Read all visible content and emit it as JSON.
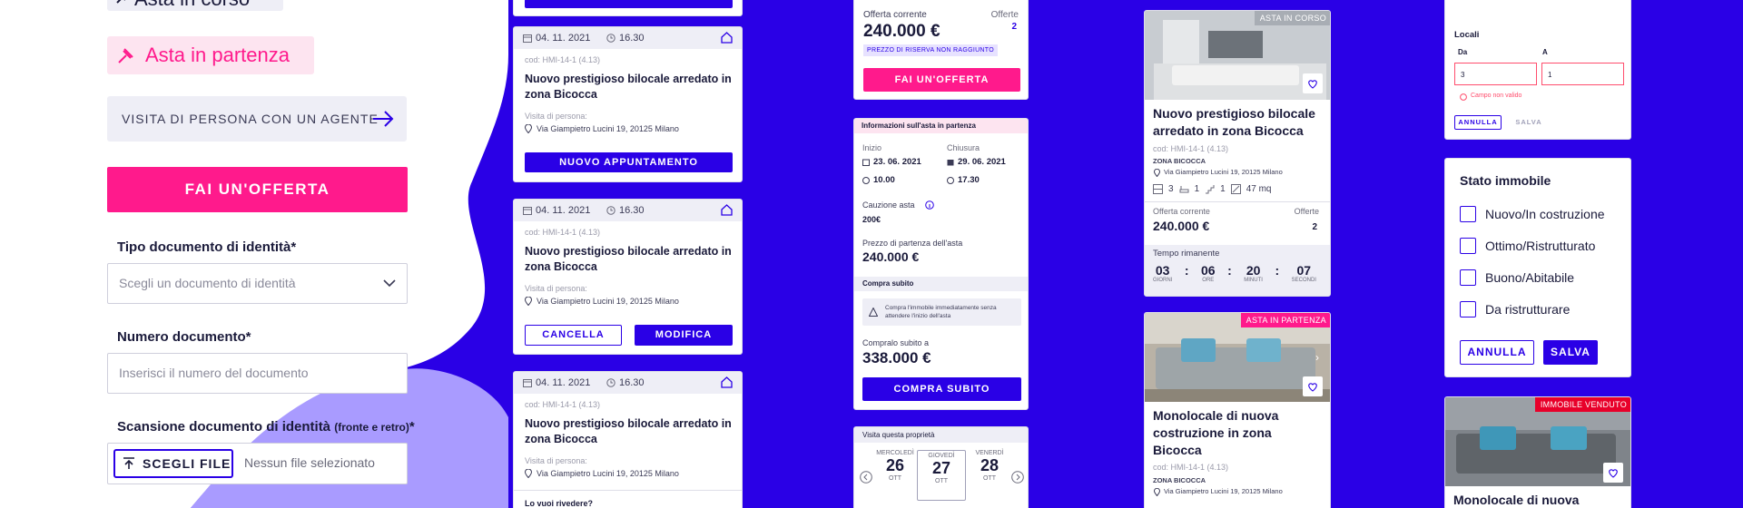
{
  "colors": {
    "accent_blue": "#2a00e6",
    "accent_pink": "#ff1a8c",
    "light_purple": "#a99bff"
  },
  "left_panel": {
    "tag_in_corso": "Asta in corso",
    "tag_in_partenza": "Asta in partenza",
    "visit_button": "VISITA DI PERSONA CON UN AGENTE",
    "offer_button": "FAI UN'OFFERTA",
    "id_type_label": "Tipo documento di identità*",
    "id_type_placeholder": "Scegli un documento di identità",
    "doc_number_label": "Numero documento*",
    "doc_number_placeholder": "Inserisci il numero del documento",
    "scan_label": "Scansione documento di identità",
    "scan_label_hint": "(fronte e retro)",
    "scan_label_star": "*",
    "choose_file": "SCEGLI FILE",
    "no_file": "Nessun file selezionato"
  },
  "appointments": {
    "cards": [
      {
        "date": "04. 11. 2021",
        "time": "16.30",
        "code": "cod: HMI-14-1 (4.13)",
        "title": "Nuovo prestigioso bilocale arredato in zona Bicocca",
        "visit_label": "Visita di persona:",
        "address": "Via Giampietro Lucini 19, 20125 Milano",
        "action": "NUOVO APPUNTAMENTO"
      },
      {
        "date": "04. 11. 2021",
        "time": "16.30",
        "code": "cod: HMI-14-1 (4.13)",
        "title": "Nuovo prestigioso bilocale arredato in zona Bicocca",
        "visit_label": "Visita di persona:",
        "address": "Via Giampietro Lucini 19, 20125 Milano",
        "cancel": "CANCELLA",
        "edit": "MODIFICA"
      },
      {
        "date": "04. 11. 2021",
        "time": "16.30",
        "code": "cod: HMI-14-1 (4.13)",
        "title": "Nuovo prestigioso bilocale arredato in zona Bicocca",
        "visit_label": "Visita di persona:",
        "address": "Via Giampietro Lucini 19, 20125 Milano",
        "footer": "Lo vuoi rivedere?"
      }
    ]
  },
  "auction_panel": {
    "current_offer_label": "Offerta corrente",
    "offers_label": "Offerte",
    "current_offer": "240.000 €",
    "offers_count": "2",
    "reserve_badge": "PREZZO DI RISERVA NON RAGGIUNTO",
    "offer_button": "FAI UN'OFFERTA",
    "info_header": "Informazioni sull'asta in partenza",
    "start_label": "Inizio",
    "end_label": "Chiusura",
    "start_date": "23. 06. 2021",
    "end_date": "29. 06. 2021",
    "start_time": "10.00",
    "end_time": "17.30",
    "deposit_label": "Cauzione asta",
    "deposit_value": "200€",
    "start_price_label": "Prezzo di partenza dell'asta",
    "start_price": "240.000 €",
    "buy_now_header": "Compra subito",
    "buy_now_info": "Compra l'immobile immediatamente senza attendere l'inizio dell'asta",
    "buy_now_price_label": "Compralo subito a",
    "buy_now_price": "338.000 €",
    "buy_now_button": "COMPRA SUBITO",
    "visit_header": "Visita questa proprietà",
    "days": [
      {
        "name": "MERCOLEDÌ",
        "num": "26",
        "month": "OTT"
      },
      {
        "name": "GIOVEDÌ",
        "num": "27",
        "month": "OTT"
      },
      {
        "name": "VENERDÌ",
        "num": "28",
        "month": "OTT"
      }
    ]
  },
  "listings": {
    "card1": {
      "badge": "ASTA IN CORSO",
      "title": "Nuovo prestigioso bilocale arredato in zona Bicocca",
      "code": "cod: HMI-14-1 (4.13)",
      "zone": "ZONA BICOCCA",
      "address": "Via Giampietro Lucini 19, 20125 Milano",
      "rooms": "3",
      "baths": "1",
      "floor": "1",
      "area": "47 mq",
      "offer_label": "Offerta corrente",
      "offers_label": "Offerte",
      "offer": "240.000 €",
      "offers": "2",
      "remaining_label": "Tempo rimanente",
      "timer": [
        {
          "v": "03",
          "l": "GIORNI"
        },
        {
          "v": "06",
          "l": "ORE"
        },
        {
          "v": "20",
          "l": "MINUTI"
        },
        {
          "v": "07",
          "l": "SECONDI"
        }
      ]
    },
    "card2": {
      "badge": "ASTA IN PARTENZA",
      "title": "Monolocale di nuova costruzione in zona Bicocca",
      "code": "cod: HMI-14-1 (4.13)",
      "zone": "ZONA BICOCCA",
      "address": "Via Giampietro Lucini 19, 20125 Milano"
    }
  },
  "filters": {
    "locali_title": "Locali",
    "da_label": "Da",
    "a_label": "A",
    "da_value": "3",
    "a_value": "1",
    "error": "Campo non valido",
    "cancel_small": "ANNULLA",
    "save_small": "SALVA",
    "stato_title": "Stato immobile",
    "options": [
      "Nuovo/In costruzione",
      "Ottimo/Ristrutturato",
      "Buono/Abitabile",
      "Da ristrutturare"
    ],
    "cancel": "ANNULLA",
    "save": "SALVA",
    "sold_badge": "IMMOBILE VENDUTO",
    "sold_title": "Monolocale di nuova"
  }
}
